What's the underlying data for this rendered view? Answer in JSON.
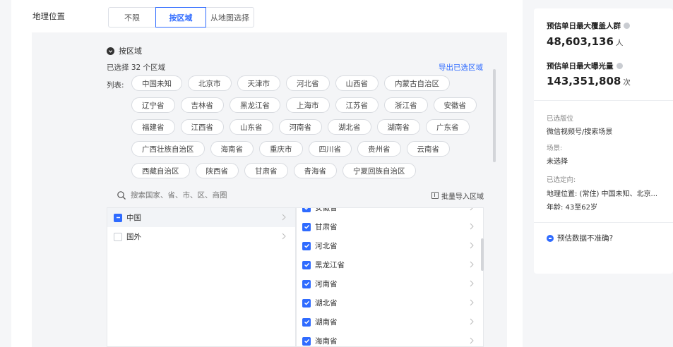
{
  "location": {
    "label": "地理位置",
    "options": [
      "不限",
      "按区域",
      "从地图选择"
    ],
    "selected": "按区域"
  },
  "region": {
    "header": "按区域",
    "selected_count": "已选择 32 个区域",
    "export_label": "导出已选区域",
    "list_label": "列表:",
    "tags": [
      [
        "中国未知",
        "北京市",
        "天津市",
        "河北省",
        "山西省",
        "内蒙古自治区"
      ],
      [
        "辽宁省",
        "吉林省",
        "黑龙江省",
        "上海市",
        "江苏省",
        "浙江省",
        "安徽省"
      ],
      [
        "福建省",
        "江西省",
        "山东省",
        "河南省",
        "湖北省",
        "湖南省",
        "广东省"
      ],
      [
        "广西壮族自治区",
        "海南省",
        "重庆市",
        "四川省",
        "贵州省",
        "云南省"
      ],
      [
        "西藏自治区",
        "陕西省",
        "甘肃省",
        "青海省",
        "宁夏回族自治区"
      ]
    ],
    "search_placeholder": "搜索国家、省、市、区、商圈",
    "batch_import": "批量导入区域",
    "countries": [
      {
        "name": "中国",
        "state": "partial"
      },
      {
        "name": "国外",
        "state": "unchecked"
      }
    ],
    "provinces": [
      "安徽省",
      "甘肃省",
      "河北省",
      "黑龙江省",
      "河南省",
      "湖北省",
      "湖南省",
      "海南省"
    ]
  },
  "summary": {
    "coverage_title": "预估单日最大覆盖人群",
    "coverage_value": "48,603,136",
    "coverage_unit": "人",
    "exposure_title": "预估单日最大曝光量",
    "exposure_value": "143,351,808",
    "exposure_unit": "次",
    "placement_label": "已选版位",
    "placement_value": "微信视频号/搜索场景",
    "scene_label": "场景:",
    "scene_value": "未选择",
    "targeting_label": "已选定向:",
    "targeting_location": "地理位置: (常住) 中国未知、北京...",
    "targeting_age": "年龄: 43至62岁",
    "inaccurate_link": "预估数据不准确?"
  },
  "colors": {
    "accent": "#2f6bff"
  }
}
